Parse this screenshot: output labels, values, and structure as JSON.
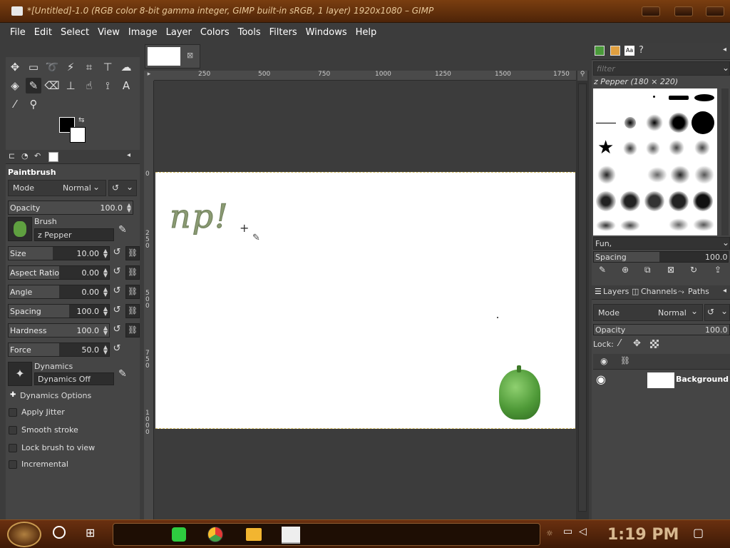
{
  "window": {
    "title": "*[Untitled]-1.0 (RGB color 8-bit gamma integer, GIMP built-in sRGB, 1 layer) 1920x1080 – GIMP"
  },
  "menubar": {
    "items": [
      "File",
      "Edit",
      "Select",
      "View",
      "Image",
      "Layer",
      "Colors",
      "Tools",
      "Filters",
      "Windows",
      "Help"
    ]
  },
  "tool_options": {
    "title": "Paintbrush",
    "mode_label": "Mode",
    "mode_value": "Normal",
    "opacity": {
      "label": "Opacity",
      "value": "100.0"
    },
    "brush": {
      "label": "Brush",
      "value": "z Pepper"
    },
    "sliders": [
      {
        "label": "Size",
        "value": "10.00",
        "fill": 0.44
      },
      {
        "label": "Aspect Ratio",
        "value": "0.00",
        "fill": 0.5
      },
      {
        "label": "Angle",
        "value": "0.00",
        "fill": 0.5
      },
      {
        "label": "Spacing",
        "value": "100.0",
        "fill": 0.6
      },
      {
        "label": "Hardness",
        "value": "100.0",
        "fill": 1.0
      },
      {
        "label": "Force",
        "value": "50.0",
        "fill": 0.5
      }
    ],
    "dynamics": {
      "label": "Dynamics",
      "value": "Dynamics Off"
    },
    "options": [
      "Dynamics Options",
      "Apply Jitter",
      "Smooth stroke",
      "Lock brush to view",
      "Incremental"
    ]
  },
  "rulers": {
    "horizontal": [
      "250",
      "500",
      "750",
      "1000",
      "1250",
      "1500",
      "1750"
    ],
    "vertical": [
      "0",
      "250",
      "500",
      "750",
      "1000"
    ]
  },
  "canvas": {
    "handwriting": "np!"
  },
  "brushes": {
    "filter_placeholder": "filter",
    "current": "z Pepper (180 × 220)",
    "tag": "Fun,",
    "spacing": {
      "label": "Spacing",
      "value": "100.0"
    }
  },
  "layers": {
    "tabs": [
      "Layers",
      "Channels",
      "Paths"
    ],
    "mode_label": "Mode",
    "mode_value": "Normal",
    "opacity": {
      "label": "Opacity",
      "value": "100.0"
    },
    "lock_label": "Lock:",
    "items": [
      {
        "name": "Background"
      }
    ]
  },
  "taskbar": {
    "time": "1:19 PM"
  }
}
